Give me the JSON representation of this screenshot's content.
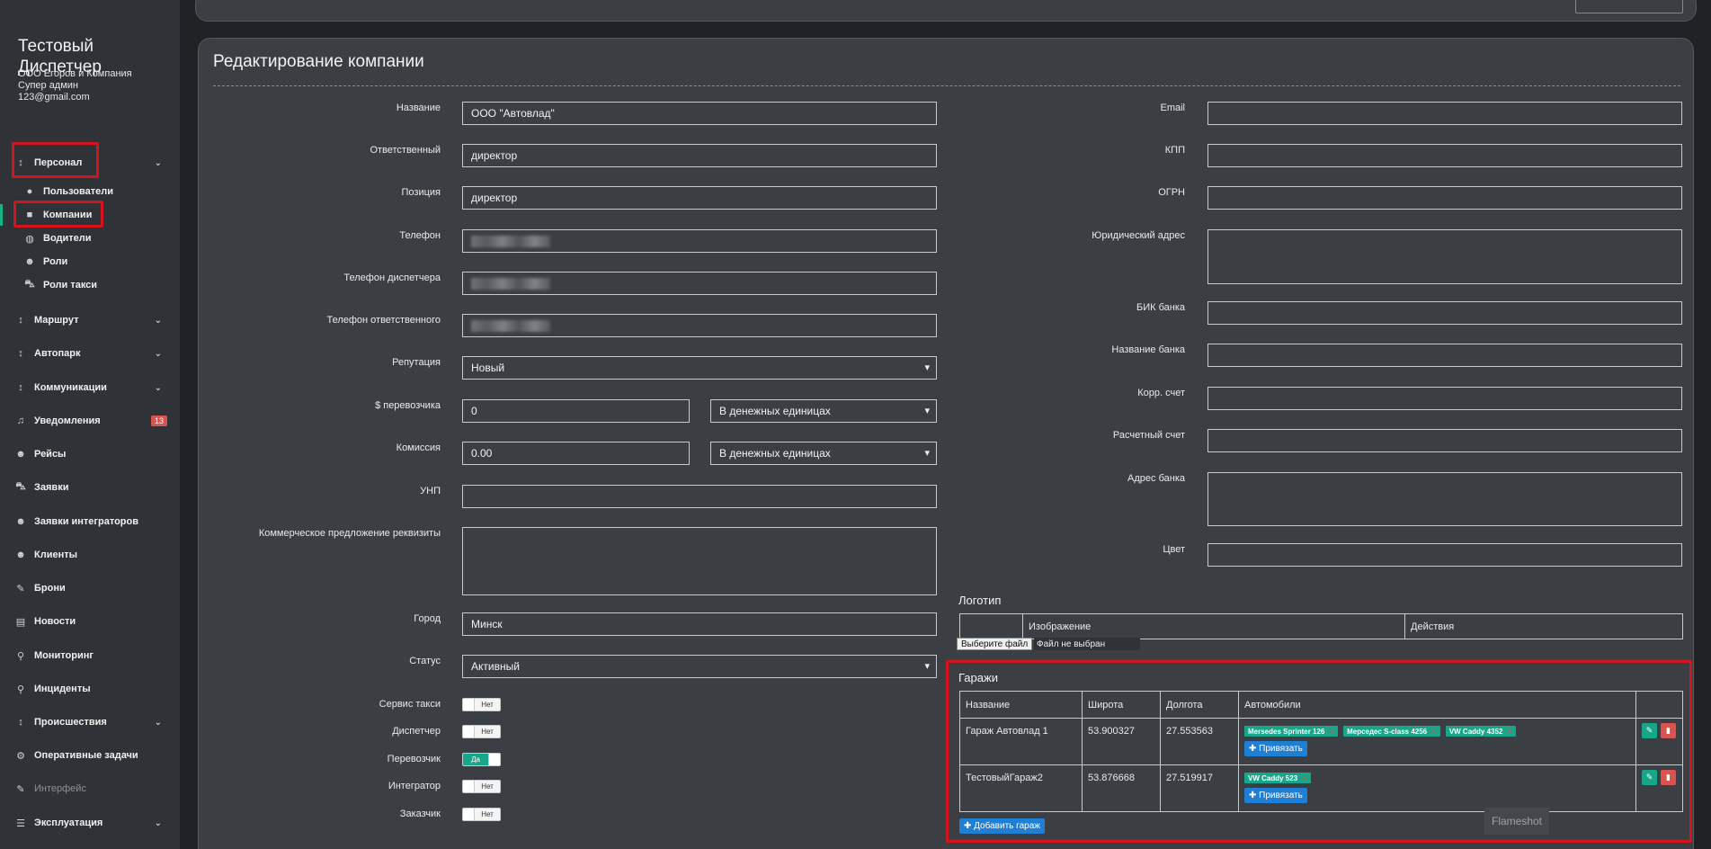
{
  "sidebar": {
    "app_title": "Тестовый Диспетчер",
    "company": "ООО Егоров и Компания",
    "role": "Супер админ",
    "email": "123@gmail.com",
    "menu": {
      "personnel": "Персонал",
      "users": "Пользователи",
      "companies": "Компании",
      "drivers": "Водители",
      "roles": "Роли",
      "taxi_roles": "Роли такси",
      "route": "Маршрут",
      "fleet": "Автопарк",
      "communications": "Коммуникации",
      "notifications": "Уведомления",
      "notifications_count": "13",
      "trips": "Рейсы",
      "requests": "Заявки",
      "integrator_requests": "Заявки интеграторов",
      "clients": "Клиенты",
      "bookings": "Брони",
      "news": "Новости",
      "monitoring": "Мониторинг",
      "incidents": "Инциденты",
      "accidents": "Происшествия",
      "tasks": "Оперативные задачи",
      "interface": "Интерфейс",
      "operation": "Эксплуатация"
    }
  },
  "page": {
    "title": "Редактирование компании"
  },
  "form": {
    "name_label": "Название",
    "name_value": "ООО \"Автовлад\"",
    "responsible_label": "Ответственный",
    "responsible_value": "директор",
    "position_label": "Позиция",
    "position_value": "директор",
    "phone_label": "Телефон",
    "dispatcher_phone_label": "Телефон диспетчера",
    "responsible_phone_label": "Телефон ответственного",
    "reputation_label": "Репутация",
    "reputation_value": "Новый",
    "carrier_label": "$ перевозчика",
    "carrier_value": "0",
    "carrier_unit": "В денежных единицах",
    "commission_label": "Комиссия",
    "commission_value": "0.00",
    "commission_unit": "В денежных единицах",
    "unp_label": "УНП",
    "offer_label": "Коммерческое предложение реквизиты",
    "city_label": "Город",
    "city_value": "Минск",
    "status_label": "Статус",
    "status_value": "Активный",
    "taxi_service_label": "Сервис такси",
    "taxi_service_value": "Нет",
    "dispatcher_label": "Диспетчер",
    "dispatcher_value": "Нет",
    "carrier_toggle_label": "Перевозчик",
    "carrier_toggle_value": "Да",
    "integrator_label": "Интегратор",
    "integrator_value": "Нет",
    "customer_label": "Заказчик",
    "customer_value": "Нет",
    "email_label": "Email",
    "kpp_label": "КПП",
    "ogrn_label": "ОГРН",
    "legal_address_label": "Юридический адрес",
    "bik_label": "БИК банка",
    "bank_name_label": "Название банка",
    "corr_account_label": "Корр. счет",
    "settlement_account_label": "Расчетный счет",
    "bank_address_label": "Адрес банка",
    "color_label": "Цвет"
  },
  "logo": {
    "title": "Логотип",
    "col_image": "Изображение",
    "col_actions": "Действия",
    "file_button": "Выберите файл",
    "file_status": "Файл не выбран"
  },
  "garages": {
    "title": "Гаражи",
    "columns": [
      "Название",
      "Широта",
      "Долгота",
      "Автомобили"
    ],
    "rows": [
      {
        "name": "Гараж Автовлад 1",
        "lat": "53.900327",
        "lng": "27.553563",
        "cars": [
          "Mersedes Sprinter 126",
          "Мерседес S-class 4256",
          "VW Caddy 4352"
        ]
      },
      {
        "name": "ТестовыйГараж2",
        "lat": "53.876668",
        "lng": "27.519917",
        "cars": [
          "VW Caddy 523"
        ]
      }
    ],
    "attach_button": "Привязать",
    "add_button": "Добавить гараж"
  },
  "overlay": {
    "flameshot": "Flameshot"
  },
  "colors": {
    "accent_green": "#17a689",
    "primary_blue": "#1f7fd4",
    "danger_red": "#d9534f",
    "highlight_red": "#d4141c"
  },
  "icons": [
    "chevron-down-icon",
    "user-icon",
    "briefcase-icon",
    "steering-icon",
    "users-icon",
    "car-icon",
    "bell-icon",
    "bus-icon",
    "edit-icon",
    "map-marker-icon",
    "newspaper-icon",
    "cogs-icon",
    "list-icon",
    "pencil-icon",
    "trash-icon",
    "plus-icon",
    "close-icon"
  ]
}
